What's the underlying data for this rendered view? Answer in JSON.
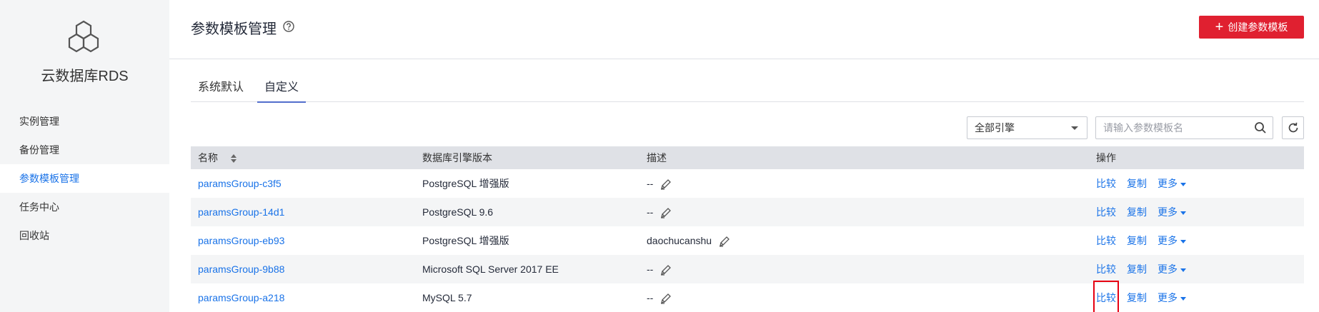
{
  "sidebar": {
    "service_title": "云数据库RDS",
    "items": [
      {
        "label": "实例管理"
      },
      {
        "label": "备份管理"
      },
      {
        "label": "参数模板管理"
      },
      {
        "label": "任务中心"
      },
      {
        "label": "回收站"
      }
    ],
    "active_index": 2
  },
  "header": {
    "title": "参数模板管理",
    "create_button": "创建参数模板"
  },
  "tabs": [
    {
      "label": "系统默认"
    },
    {
      "label": "自定义"
    }
  ],
  "toolbar": {
    "engine_select": "全部引擎",
    "search_placeholder": "请输入参数模板名"
  },
  "table": {
    "columns": [
      "名称",
      "数据库引擎版本",
      "描述",
      "操作"
    ],
    "rows": [
      {
        "name": "paramsGroup-c3f5",
        "engine": "PostgreSQL 增强版",
        "desc": "--"
      },
      {
        "name": "paramsGroup-14d1",
        "engine": "PostgreSQL 9.6",
        "desc": "--"
      },
      {
        "name": "paramsGroup-eb93",
        "engine": "PostgreSQL 增强版",
        "desc": "daochucanshu"
      },
      {
        "name": "paramsGroup-9b88",
        "engine": "Microsoft SQL Server 2017 EE",
        "desc": "--"
      },
      {
        "name": "paramsGroup-a218",
        "engine": "MySQL 5.7",
        "desc": "--"
      }
    ],
    "actions": {
      "compare": "比较",
      "copy": "复制",
      "more": "更多"
    }
  },
  "colors": {
    "accent": "#1a73e8",
    "primary_button": "#e02030",
    "highlight_box": "#e60012",
    "sidebar_bg": "#f4f5f6",
    "table_header_bg": "#dfe1e6"
  },
  "icons": [
    "rds-logo-icon",
    "help-icon",
    "plus-icon",
    "chevron-down-icon",
    "search-icon",
    "refresh-icon",
    "sort-icon",
    "edit-icon"
  ]
}
